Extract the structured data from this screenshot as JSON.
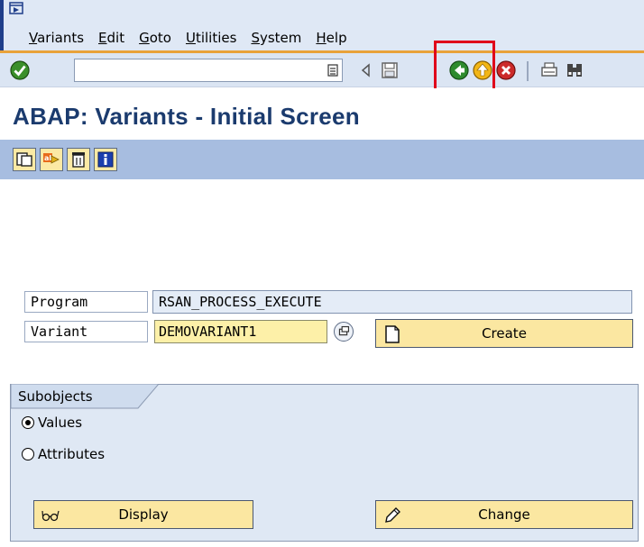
{
  "menu": {
    "items": [
      {
        "label": "Variants",
        "u": "V",
        "rest": "ariants"
      },
      {
        "label": "Edit",
        "u": "E",
        "rest": "dit"
      },
      {
        "label": "Goto",
        "u": "G",
        "rest": "oto"
      },
      {
        "label": "Utilities",
        "u": "U",
        "rest": "tilities"
      },
      {
        "label": "System",
        "u": "S",
        "rest": "ystem"
      },
      {
        "label": "Help",
        "u": "H",
        "rest": "elp"
      }
    ]
  },
  "toolbar": {
    "command_value": "",
    "icons": [
      "enter-icon",
      "command-dropdown-icon",
      "back-arrow-small-icon",
      "save-icon",
      "back-icon",
      "exit-icon",
      "cancel-icon",
      "print-icon",
      "find-icon"
    ]
  },
  "title": "ABAP: Variants - Initial Screen",
  "app_toolbar": {
    "icons": [
      "copy-icon",
      "rename-icon",
      "delete-icon",
      "info-icon"
    ]
  },
  "form": {
    "program_label": "Program",
    "program_value": "RSAN_PROCESS_EXECUTE",
    "variant_label": "Variant",
    "variant_value": "DEMOVARIANT1",
    "create_label": "Create"
  },
  "subobjects": {
    "tab_label": "Subobjects",
    "options": [
      {
        "label": "Values",
        "selected": true
      },
      {
        "label": "Attributes",
        "selected": false
      }
    ],
    "display_label": "Display",
    "change_label": "Change"
  },
  "colors": {
    "title": "#1b3b6e",
    "app_toolbar": "#a7bde0",
    "button": "#fbe7a1",
    "highlight": "#e0001a"
  }
}
